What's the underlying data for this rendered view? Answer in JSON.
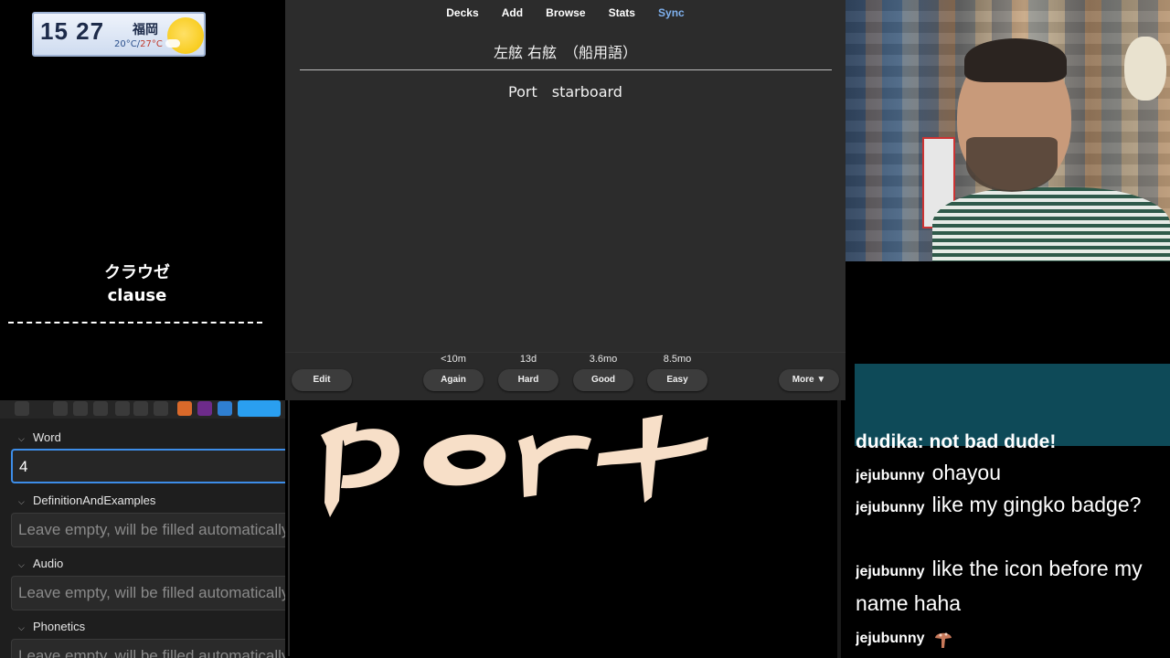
{
  "weather": {
    "time": "15 27",
    "city": "福岡",
    "temp_low": "20°C",
    "temp_sep": "/",
    "temp_high": "27°C",
    "icon": "sun-icon"
  },
  "subtitle": {
    "jp": "クラウゼ",
    "en": "clause"
  },
  "anki": {
    "nav": [
      "Decks",
      "Add",
      "Browse",
      "Stats",
      "Sync"
    ],
    "card_front": "左舷 右舷　（船用語）",
    "card_back": "Port　starboard",
    "buttons": {
      "edit": "Edit",
      "again": {
        "label": "Again",
        "interval": "<10m"
      },
      "hard": {
        "label": "Hard",
        "interval": "13d"
      },
      "good": {
        "label": "Good",
        "interval": "3.6mo"
      },
      "easy": {
        "label": "Easy",
        "interval": "8.5mo"
      },
      "more": "More ▼"
    }
  },
  "editor": {
    "fields": [
      {
        "name": "Word",
        "value": "4"
      },
      {
        "name": "DefinitionAndExamples",
        "placeholder": "Leave empty, will be filled automatically"
      },
      {
        "name": "Audio",
        "placeholder": "Leave empty, will be filled automatically"
      },
      {
        "name": "Phonetics",
        "placeholder": "Leave empty, will be filled automatically"
      }
    ]
  },
  "handwriting": {
    "text": "port",
    "ink_color": "#f7dfc8"
  },
  "chat": {
    "cut_line": "dudika: not bad dude!",
    "messages": [
      {
        "user": "jejubunny",
        "text": "ohayou"
      },
      {
        "user": "jejubunny",
        "text": "like my gingko badge?"
      },
      {
        "user": "jejubunny",
        "text": "like the icon before my name haha"
      },
      {
        "user": "jejubunny",
        "text": "",
        "emote": "mushroom-emote-icon"
      }
    ]
  },
  "colors": {
    "accent": "#7fb1ee",
    "active_field": "#3d8de8",
    "chat_banner": "#0e4a58"
  }
}
